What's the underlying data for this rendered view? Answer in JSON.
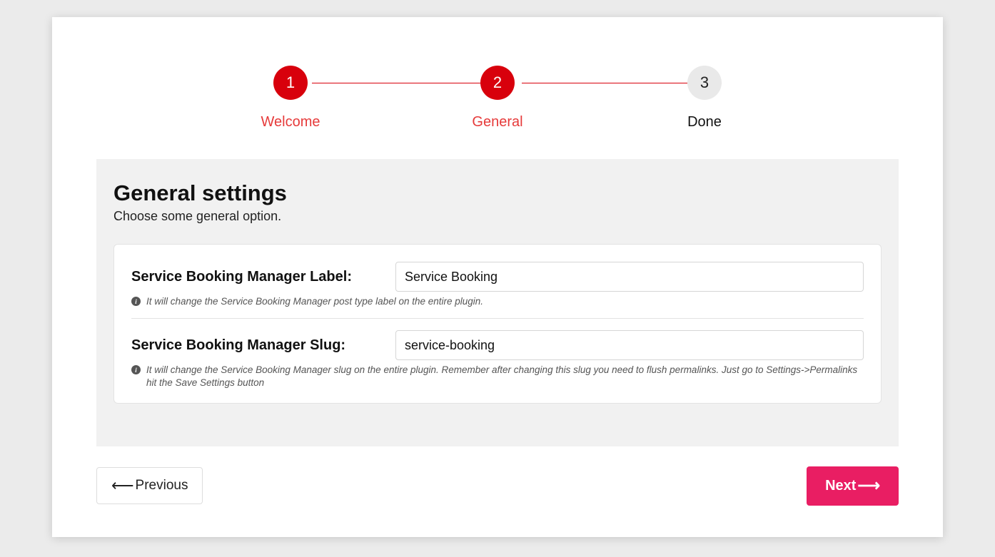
{
  "stepper": {
    "steps": [
      {
        "num": "1",
        "label": "Welcome",
        "active": true
      },
      {
        "num": "2",
        "label": "General",
        "active": true
      },
      {
        "num": "3",
        "label": "Done",
        "active": false
      }
    ]
  },
  "panel": {
    "title": "General settings",
    "subtitle": "Choose some general option."
  },
  "fields": {
    "label_field": {
      "label": "Service Booking Manager Label:",
      "value": "Service Booking",
      "hint": "It will change the Service Booking Manager post type label on the entire plugin."
    },
    "slug_field": {
      "label": "Service Booking Manager Slug:",
      "value": "service-booking",
      "hint": "It will change the Service Booking Manager slug on the entire plugin. Remember after changing this slug you need to flush permalinks. Just go to Settings->Permalinks hit the Save Settings button"
    }
  },
  "nav": {
    "prev": "Previous",
    "next": "Next"
  }
}
